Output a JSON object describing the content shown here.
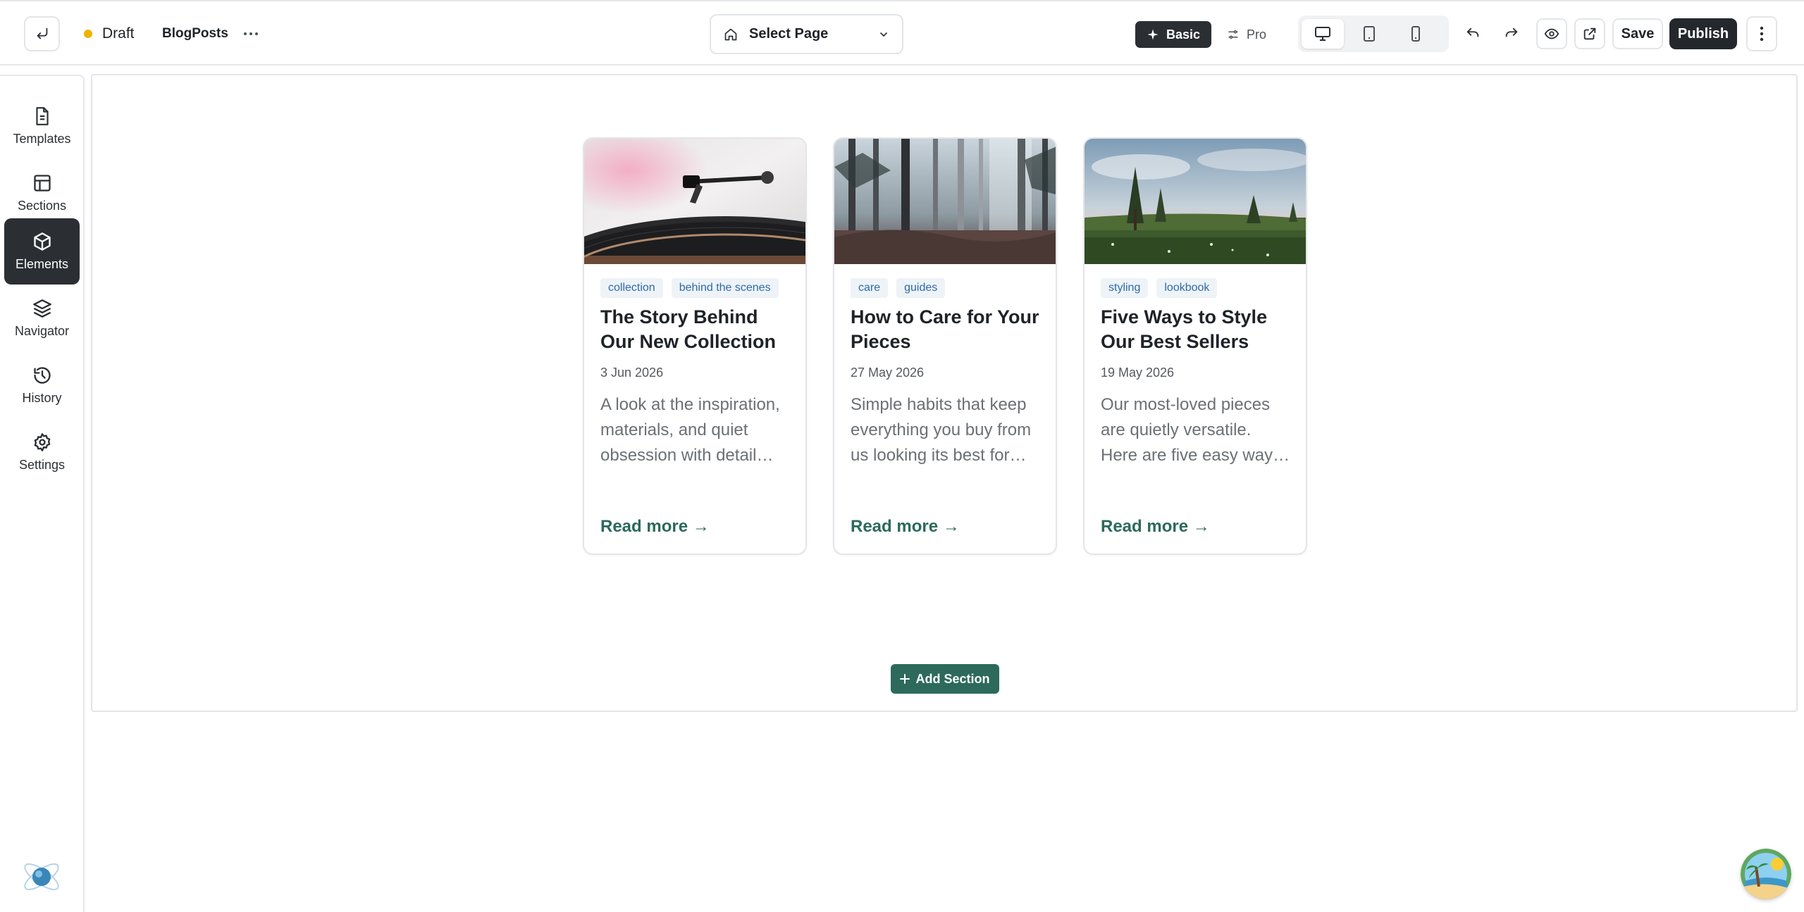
{
  "topbar": {
    "status_label": "Draft",
    "page_name": "BlogPosts",
    "select_page_label": "Select Page",
    "modes": [
      {
        "label": "Basic",
        "active": true
      },
      {
        "label": "Pro",
        "active": false
      }
    ],
    "devices": [
      "desktop-icon",
      "tablet-icon",
      "mobile-icon"
    ],
    "save_label": "Save",
    "publish_label": "Publish",
    "colors": {
      "status_dot": "#f0b400",
      "publish_bg": "#24282c"
    }
  },
  "sidebar": {
    "items": [
      {
        "label": "Templates",
        "icon": "file-icon",
        "active": false
      },
      {
        "label": "Sections",
        "icon": "layout-icon",
        "active": false
      },
      {
        "label": "Elements",
        "icon": "cube-icon",
        "active": true
      },
      {
        "label": "Navigator",
        "icon": "layers-icon",
        "active": false
      },
      {
        "label": "History",
        "icon": "history-icon",
        "active": false
      },
      {
        "label": "Settings",
        "icon": "gear-icon",
        "active": false
      }
    ]
  },
  "posts": [
    {
      "tags": [
        "collection",
        "behind the scenes"
      ],
      "title": "The Story Behind Our New Collection",
      "date": "3 Jun 2026",
      "excerpt": "A look at the inspiration, materials, and quiet obsession with detail…",
      "read_more": "Read more →",
      "image": "turntable-photo"
    },
    {
      "tags": [
        "care",
        "guides"
      ],
      "title": "How to Care for Your Pieces",
      "date": "27 May 2026",
      "excerpt": "Simple habits that keep everything you buy from us looking its best for…",
      "read_more": "Read more →",
      "image": "misty-forest-photo"
    },
    {
      "tags": [
        "styling",
        "lookbook"
      ],
      "title": "Five Ways to Style Our Best Sellers",
      "date": "19 May 2026",
      "excerpt": "Our most-loved pieces are quietly versatile. Here are five easy way…",
      "read_more": "Read more →",
      "image": "meadow-photo"
    }
  ],
  "canvas": {
    "add_section_label": "Add Section",
    "accent_color": "#2d6a5c"
  }
}
